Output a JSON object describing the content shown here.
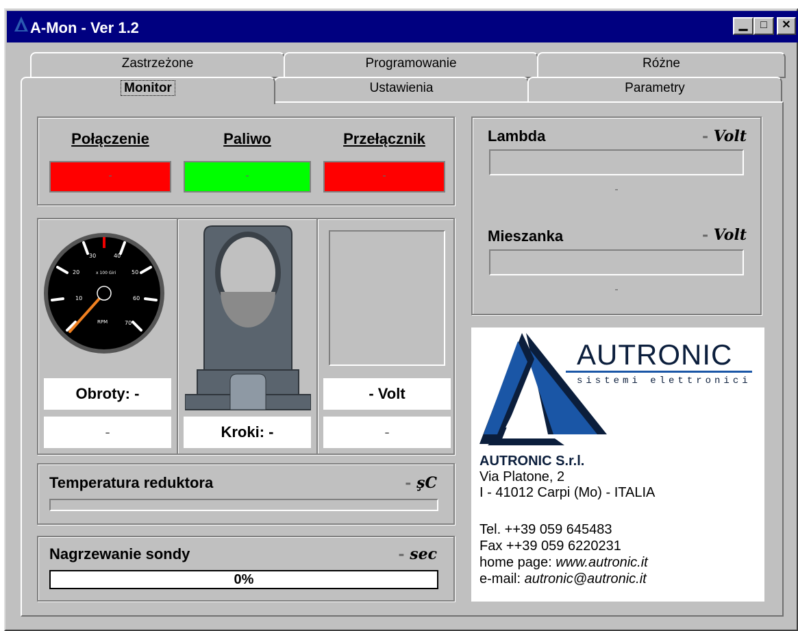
{
  "window": {
    "title": "A-Mon - Ver 1.2",
    "buttons": {
      "minimize": "▁",
      "maximize": "□",
      "close": "✕"
    }
  },
  "tabs": {
    "back_row": [
      "Zastrzeżone",
      "Programowanie",
      "Różne"
    ],
    "front_row": [
      "Monitor",
      "Ustawienia",
      "Parametry"
    ],
    "active": "Monitor"
  },
  "status": {
    "polaczenie": {
      "label": "Połączenie",
      "value": "-",
      "color": "#ff0000"
    },
    "paliwo": {
      "label": "Paliwo",
      "value": "-",
      "color": "#00ff00"
    },
    "przelacznik": {
      "label": "Przełącznik",
      "value": "-",
      "color": "#ff0000"
    }
  },
  "gauge": {
    "ticks": [
      "10",
      "20",
      "30",
      "40",
      "50",
      "60",
      "70"
    ],
    "center_text": "x 100 Giri",
    "bottom_text": "RPM"
  },
  "obroty": {
    "label": "Obroty:",
    "value": "-",
    "secondary": "-"
  },
  "kroki": {
    "label": "Kroki:",
    "value": "-"
  },
  "volt_box": {
    "value": "-",
    "unit": "Volt",
    "secondary": "-"
  },
  "lambda": {
    "label": "Lambda",
    "value": "-",
    "unit": "Volt",
    "reading": "-"
  },
  "mieszanka": {
    "label": "Mieszanka",
    "value": "-",
    "unit": "Volt",
    "reading": "-"
  },
  "temperatura": {
    "label": "Temperatura reduktora",
    "value": "-",
    "unit": "şC"
  },
  "nagrzewanie": {
    "label": "Nagrzewanie sondy",
    "value": "-",
    "unit": "sec",
    "progress_text": "0%",
    "progress": 0
  },
  "company": {
    "logo_name": "AUTRONIC",
    "logo_sub": "sistemi elettronici",
    "name": "AUTRONIC S.r.l.",
    "address1": "Via Platone, 2",
    "address2": "I - 41012 Carpi (Mo) - ITALIA",
    "tel": "Tel. ++39 059 645483",
    "fax": "Fax ++39 059 6220231",
    "home_label": "home page: ",
    "home_value": "www.autronic.it",
    "email_label": "e-mail: ",
    "email_value": "autronic@autronic.it",
    "colors": {
      "blue": "#1a56a6",
      "dark": "#0b1e3c"
    }
  }
}
